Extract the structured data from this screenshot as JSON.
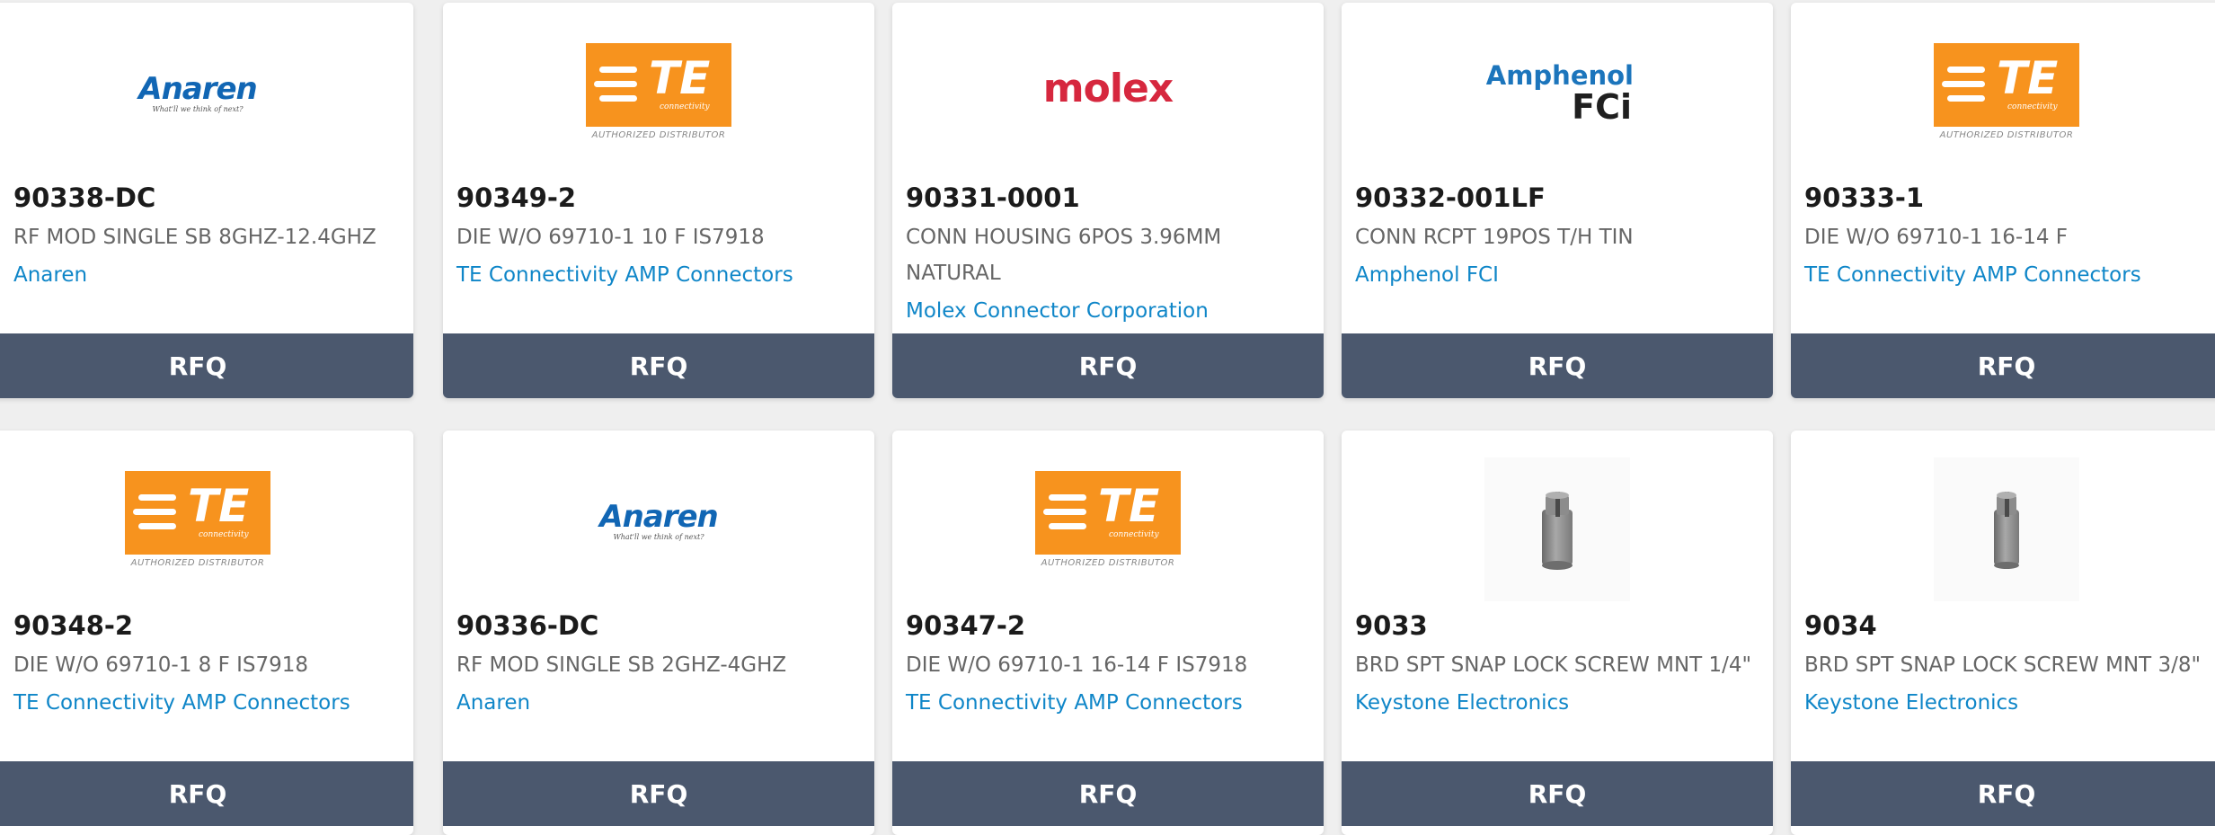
{
  "products": [
    {
      "part": "90338-DC",
      "desc": "RF MOD SINGLE SB 8GHZ-12.4GHZ",
      "mfr": "Anaren",
      "logo": "anaren",
      "rfq": "RFQ"
    },
    {
      "part": "90349-2",
      "desc": "DIE W/O 69710-1 10 F IS7918",
      "mfr": "TE Connectivity AMP Connectors",
      "logo": "te",
      "rfq": "RFQ"
    },
    {
      "part": "90331-0001",
      "desc": "CONN HOUSING 6POS 3.96MM NATURAL",
      "mfr": "Molex Connector Corporation",
      "logo": "molex",
      "rfq": "RFQ"
    },
    {
      "part": "90332-001LF",
      "desc": "CONN RCPT 19POS T/H TIN",
      "mfr": "Amphenol FCI",
      "logo": "amphenol",
      "rfq": "RFQ"
    },
    {
      "part": "90333-1",
      "desc": "DIE W/O 69710-1 16-14 F",
      "mfr": "TE Connectivity AMP Connectors",
      "logo": "te",
      "rfq": "RFQ"
    },
    {
      "part": "90348-2",
      "desc": "DIE W/O 69710-1 8 F IS7918",
      "mfr": "TE Connectivity AMP Connectors",
      "logo": "te",
      "rfq": "RFQ"
    },
    {
      "part": "90336-DC",
      "desc": "RF MOD SINGLE SB 2GHZ-4GHZ",
      "mfr": "Anaren",
      "logo": "anaren",
      "rfq": "RFQ"
    },
    {
      "part": "90347-2",
      "desc": "DIE W/O 69710-1 16-14 F IS7918",
      "mfr": "TE Connectivity AMP Connectors",
      "logo": "te",
      "rfq": "RFQ"
    },
    {
      "part": "9033",
      "desc": "BRD SPT SNAP LOCK SCREW MNT 1/4\"",
      "mfr": "Keystone Electronics",
      "logo": "screw-photo",
      "rfq": "RFQ"
    },
    {
      "part": "9034",
      "desc": "BRD SPT SNAP LOCK SCREW MNT 3/8\"",
      "mfr": "Keystone Electronics",
      "logo": "screw-photo",
      "rfq": "RFQ"
    }
  ],
  "logos": {
    "anaren": {
      "word": "Anaren",
      "tagline": "What'll we think of next?"
    },
    "te": {
      "word": "TE",
      "sub": "connectivity",
      "caption": "AUTHORIZED DISTRIBUTOR"
    },
    "molex": {
      "word": "molex"
    },
    "amphenol": {
      "line1": "Amphenol",
      "line2": "FCi"
    }
  },
  "colors": {
    "rfq_bg": "#4b586e",
    "link": "#0f86c8",
    "te_orange": "#f7931e"
  }
}
